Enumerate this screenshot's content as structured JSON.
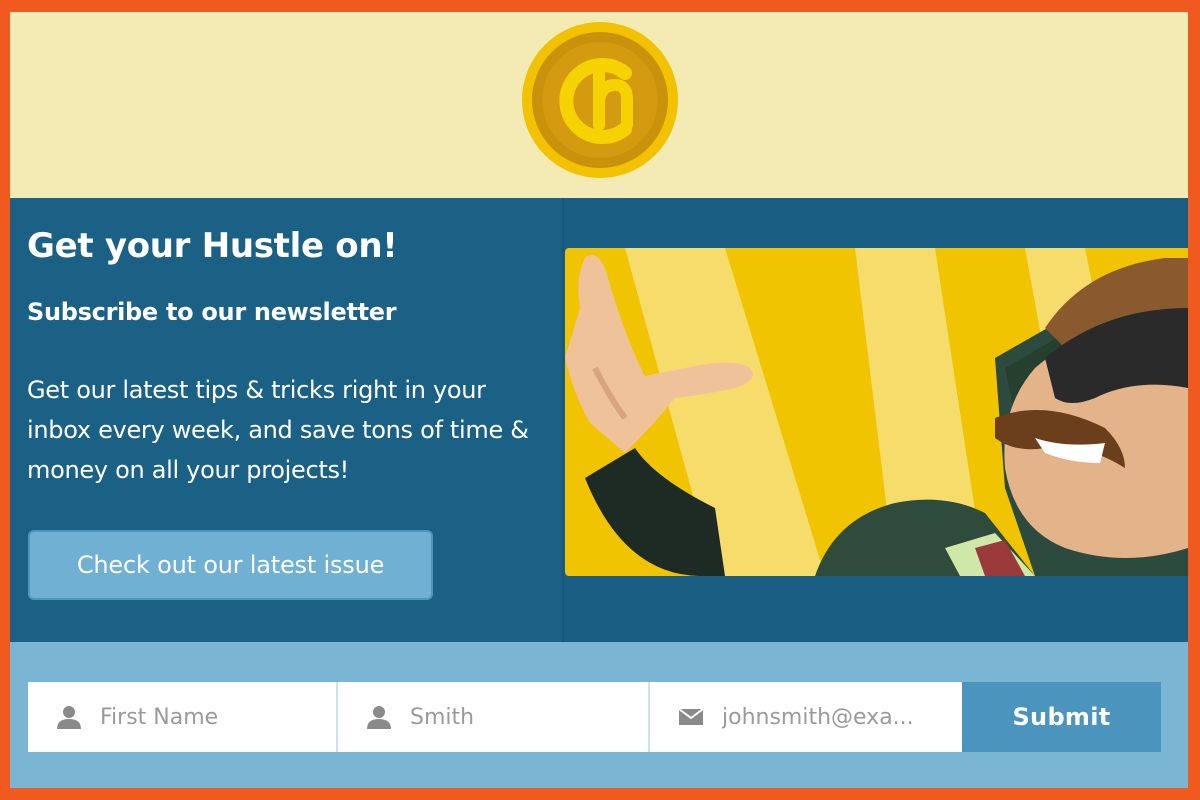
{
  "colors": {
    "frame": "#f15a1e",
    "header_bg": "#f4ebb4",
    "main_bg": "#1b6186",
    "cta_bg": "#6fb0d3",
    "form_bar_bg": "#7ab5d3",
    "submit_bg": "#4a94bd",
    "logo_gold": "#f2c200"
  },
  "header": {
    "logo_icon": "hustle-coin-logo"
  },
  "content": {
    "title": "Get your Hustle on!",
    "subtitle": "Subscribe to our newsletter",
    "description": "Get our latest tips & tricks right in your inbox every week, and save tons of time & money on all your projects!",
    "cta_label": "Check out our latest issue",
    "hero_icon": "superhero-illustration"
  },
  "form": {
    "first_name": {
      "placeholder": "First Name",
      "value": "",
      "icon": "user-icon"
    },
    "last_name": {
      "placeholder": "Smith",
      "value": "",
      "icon": "user-icon"
    },
    "email": {
      "placeholder": "johnsmith@exa...",
      "value": "",
      "icon": "envelope-icon"
    },
    "submit_label": "Submit"
  }
}
